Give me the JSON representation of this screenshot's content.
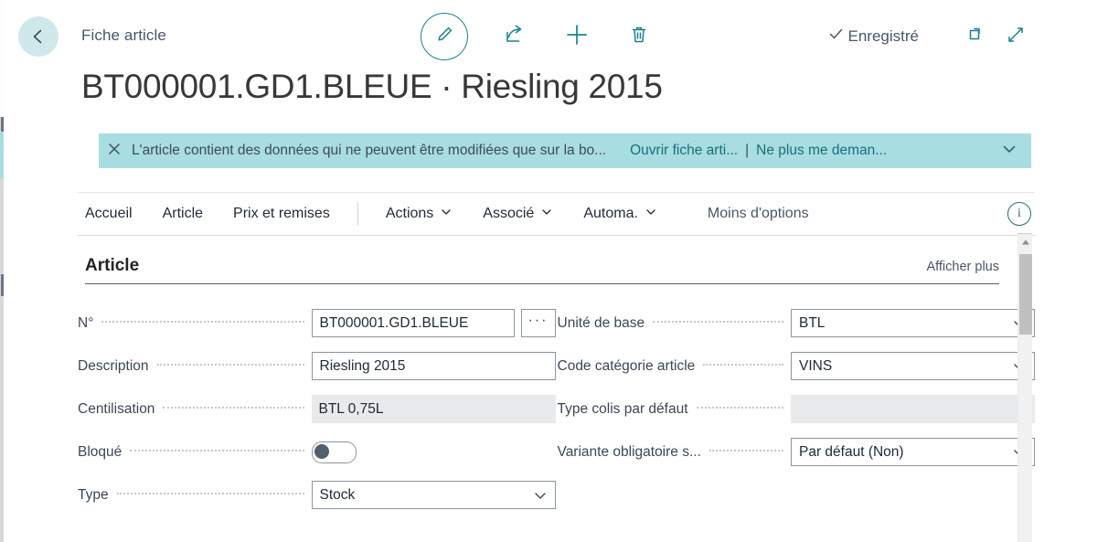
{
  "colors": {
    "accent_teal": "#18828c",
    "back_circle": "#cfe9ea",
    "banner_bg": "#a8dde1",
    "banner_link": "#17707c",
    "label_text": "#3d4656",
    "scroll_thumb": "#c0c0c0"
  },
  "topbar": {
    "back_icon": "arrow-left-icon",
    "breadcrumb": "Fiche article",
    "tools": [
      {
        "icon": "pencil-edit-icon",
        "circled": true
      },
      {
        "icon": "share-icon",
        "circled": false
      },
      {
        "icon": "plus-new-icon",
        "circled": false
      },
      {
        "icon": "trash-delete-icon",
        "circled": false
      }
    ],
    "saved_status": "Enregistré",
    "saved_icon": "checkmark-icon",
    "open_new_window_icon": "open-in-new-window-icon",
    "expand_icon": "expand-fullscreen-icon"
  },
  "title": "BT000001.GD1.BLEUE · Riesling 2015",
  "banner": {
    "close_icon": "close-x-icon",
    "message": "L'article contient des données qui ne peuvent être modifiées que sur la bo...",
    "action_primary": "Ouvrir fiche arti...",
    "separator": "|",
    "action_secondary": "Ne plus me deman...",
    "chevron_icon": "chevron-down-icon"
  },
  "ribbon": {
    "tabs": [
      {
        "label": "Accueil",
        "caret": false
      },
      {
        "label": "Article",
        "caret": false
      },
      {
        "label": "Prix et remises",
        "caret": false
      }
    ],
    "menus": [
      {
        "label": "Actions",
        "caret": true
      },
      {
        "label": "Associé",
        "caret": true
      },
      {
        "label": "Automa.",
        "caret": true
      }
    ],
    "more_options": "Moins d'options",
    "info_icon": "info-circle-icon",
    "info_glyph": "i"
  },
  "section": {
    "title": "Article",
    "show_more": "Afficher plus"
  },
  "form": {
    "left": [
      {
        "label": "N°",
        "type": "text",
        "value": "BT000001.GD1.BLEUE",
        "placeholder": "",
        "assist": "···",
        "width": "w-no"
      },
      {
        "label": "Description",
        "type": "text",
        "value": "Riesling 2015",
        "placeholder": "",
        "width": "w-std"
      },
      {
        "label": "Centilisation",
        "type": "readonly",
        "value": "BTL 0,75L",
        "width": "w-std"
      },
      {
        "label": "Bloqué",
        "type": "toggle",
        "value": "off"
      },
      {
        "label": "Type",
        "type": "select",
        "value": "Stock",
        "width": "w-std"
      }
    ],
    "right": [
      {
        "label": "Unité de base",
        "type": "select",
        "value": "BTL",
        "width": "w-std"
      },
      {
        "label": "Code catégorie article",
        "type": "select",
        "value": "VINS",
        "width": "w-std"
      },
      {
        "label": "Type colis par défaut",
        "type": "readonly",
        "value": "",
        "width": "w-wide"
      },
      {
        "label": "Variante obligatoire s...",
        "type": "select",
        "value": "Par défaut (Non)",
        "width": "w-std"
      }
    ]
  },
  "scrollbar": {
    "up_arrow_icon": "scroll-up-arrow-icon",
    "thumb": "vertical-scroll-thumb"
  }
}
